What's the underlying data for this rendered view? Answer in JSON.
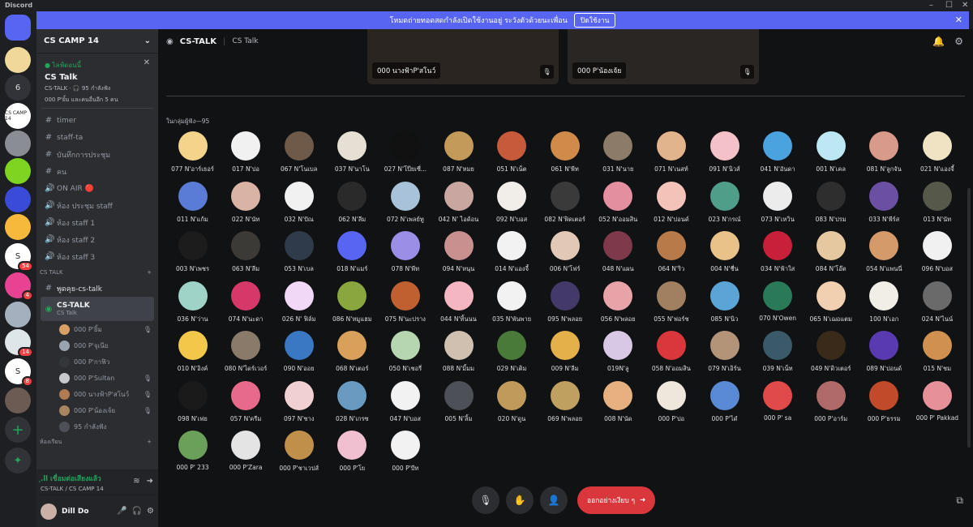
{
  "app": {
    "title": "Discord",
    "window_controls": [
      "–",
      "☐",
      "✕"
    ]
  },
  "banner": {
    "text": "โหมดถ่ายทอดสดกำลังเปิดใช้งานอยู่ ระวังตัวด้วยนะเพื่อน",
    "button": "ปิดใช้งาน",
    "close": "✕"
  },
  "rail": {
    "servers": [
      {
        "label": "",
        "color": "#5865f2",
        "icon": "discord-icon"
      },
      {
        "label": "",
        "color": "#f0d89a",
        "icon": "server-icon"
      },
      {
        "label": "6",
        "color": "#313338",
        "icon": ""
      },
      {
        "label": "CS CAMP 14",
        "color": "#ffffff",
        "icon": ""
      },
      {
        "label": "",
        "color": "#8a8d93",
        "icon": "server-icon"
      },
      {
        "label": "",
        "color": "#7fd321",
        "icon": ""
      },
      {
        "label": "",
        "color": "#3b4bd9",
        "icon": "server-icon"
      },
      {
        "label": "",
        "color": "#f6b93b",
        "icon": "server-icon"
      },
      {
        "label": "S",
        "color": "#ffffff",
        "icon": "",
        "badge": "54"
      },
      {
        "label": "",
        "color": "#e84393",
        "icon": "server-icon",
        "badge": "4"
      },
      {
        "label": "",
        "color": "#a4b0be",
        "icon": "server-icon"
      },
      {
        "label": "",
        "color": "#dfe6e9",
        "icon": "server-icon",
        "badge": "14"
      },
      {
        "label": "S",
        "color": "#ffffff",
        "icon": "",
        "badge": "8"
      },
      {
        "label": "",
        "color": "#6b5b53",
        "icon": "server-icon"
      }
    ],
    "add": "+",
    "explore": "✦"
  },
  "sidebar": {
    "server_name": "CS CAMP 14",
    "live": {
      "status": "● ไลฟ์ตอนนี้",
      "title": "CS Talk",
      "sub1": "CS-TALK · 🎧 95 กำลังฟัง",
      "sub2": "000 P'ยิ้ม และคนอื่นอีก 5 คน"
    },
    "channels_top": [
      {
        "icon": "#",
        "label": "timer"
      },
      {
        "icon": "#",
        "label": "staff-ta"
      },
      {
        "icon": "#",
        "label": "บันทึกการประชุม"
      },
      {
        "icon": "#",
        "label": "คน"
      },
      {
        "icon": "🔊",
        "label": "ON AIR 🔴"
      },
      {
        "icon": "🔊",
        "label": "ห้อง ประชุม staff"
      },
      {
        "icon": "🔊",
        "label": "ห้อง staff 1"
      },
      {
        "icon": "🔊",
        "label": "ห้อง staff 2"
      },
      {
        "icon": "🔊",
        "label": "ห้อง staff 3"
      }
    ],
    "category": "CS TALK",
    "channel_text": "พูดคุย-cs-talk",
    "stage": {
      "label": "CS-TALK",
      "sub": "CS Talk"
    },
    "voice_users": [
      {
        "name": "000 P'ยิ้ม",
        "color": "#d9a066"
      },
      {
        "name": "000 P'จุเนีย",
        "color": "#9aa3b0"
      },
      {
        "name": "000 P'กาฟิว",
        "color": "#33363b"
      },
      {
        "name": "000 P'Sultan",
        "color": "#c7c9cc"
      },
      {
        "name": "000 นางฟ้าP'สโนว์",
        "color": "#b07a52"
      },
      {
        "name": "000 P'น้องเจ้ย",
        "color": "#a6855f"
      },
      {
        "name": "95 กำลังฟัง",
        "color": "#4e5058"
      }
    ],
    "category2": "ห้องเรียน",
    "voice_status": {
      "title": "ฺ.ll เชื่อมต่อเสียงแล้ว",
      "sub": "CS-TALK / CS CAMP 14"
    },
    "user": {
      "name": "Dill Do"
    }
  },
  "header": {
    "name": "CS-TALK",
    "sub": "CS Talk"
  },
  "speakers": [
    {
      "name": "000 นางฟ้าP'สโนว์"
    },
    {
      "name": "000 P'น้องเจ้ย"
    }
  ],
  "audience_label": "ในกลุ่มผู้ฟัง—95",
  "audience": [
    {
      "name": "077 N'อาร์เธอร์",
      "color": "#f4d48a"
    },
    {
      "name": "017 N'ปอ",
      "color": "#f1f1f1"
    },
    {
      "name": "067 N'โนเบล",
      "color": "#6f5a4a"
    },
    {
      "name": "037 N'นาโน",
      "color": "#e6e0d4"
    },
    {
      "name": "027 N'โป๊ยเซี่...",
      "color": "#111111"
    },
    {
      "name": "087 N'หมย",
      "color": "#c49a5a"
    },
    {
      "name": "051 N'เน็ต",
      "color": "#c65a3a"
    },
    {
      "name": "061 N'พีท",
      "color": "#d08a4a"
    },
    {
      "name": "031 N'นาย",
      "color": "#8b7b68"
    },
    {
      "name": "071 N'เนสท์",
      "color": "#e2b48e"
    },
    {
      "name": "091 N'นิวส์",
      "color": "#f5c1c8"
    },
    {
      "name": "041 N'อันดา",
      "color": "#4aa3df"
    },
    {
      "name": "001 N'เคล",
      "color": "#bde7f2"
    },
    {
      "name": "081 N'ลูกจัน",
      "color": "#d89a8a"
    },
    {
      "name": "021 N'แองจี้",
      "color": "#efe3c3"
    },
    {
      "name": "011 N'แก้ม",
      "color": "#5a7bd6"
    },
    {
      "name": "022 N'นัท",
      "color": "#d9b3a4"
    },
    {
      "name": "032 N'ปัณ",
      "color": "#f1f1f1"
    },
    {
      "name": "062 N'ลีม",
      "color": "#2a2a2a"
    },
    {
      "name": "072 N'เพลย์ทู",
      "color": "#a7c2d9"
    },
    {
      "name": "042 N' ไอด้อน",
      "color": "#c9a7a0"
    },
    {
      "name": "092 N'บอส",
      "color": "#f1eeea"
    },
    {
      "name": "082 N'ฟิดเตอร์",
      "color": "#3a3a3a"
    },
    {
      "name": "052 N'ออมสิน",
      "color": "#e48fa0"
    },
    {
      "name": "012 N'ปอนด์",
      "color": "#f3c3b9"
    },
    {
      "name": "023 N'กรณ์",
      "color": "#4f9e8a"
    },
    {
      "name": "073 N'เหวิน",
      "color": "#ececec"
    },
    {
      "name": "083 N'ปรม",
      "color": "#2e2e2e"
    },
    {
      "name": "033 N'พีร์ส",
      "color": "#6a4fa3"
    },
    {
      "name": "013 N'นัท",
      "color": "#56584a"
    },
    {
      "name": "003 N'เพชร",
      "color": "#1c1c1c"
    },
    {
      "name": "063 N'ลีม",
      "color": "#3c3a36"
    },
    {
      "name": "053 N'เบล",
      "color": "#2f3b4a"
    },
    {
      "name": "018 N'แมร์",
      "color": "#5865f2"
    },
    {
      "name": "078 N'พีท",
      "color": "#9a8ee6"
    },
    {
      "name": "094 N'หนุน",
      "color": "#c99090"
    },
    {
      "name": "014 N'แองจี้",
      "color": "#f2f2f2"
    },
    {
      "name": "006 N'โฟร์",
      "color": "#e2c8b6"
    },
    {
      "name": "048 N'แผน",
      "color": "#7e3a4a"
    },
    {
      "name": "064 N'ริว",
      "color": "#b97a4a"
    },
    {
      "name": "004 N'ชื่น",
      "color": "#e9c28a"
    },
    {
      "name": "034 N'ฟ้าใส",
      "color": "#c8203a"
    },
    {
      "name": "084 N'โอ๊ต",
      "color": "#e6c8a0"
    },
    {
      "name": "054 N'แพนนี่",
      "color": "#d49a6a"
    },
    {
      "name": "096 N'บอส",
      "color": "#f1f1f1"
    },
    {
      "name": "036 N'ว่าน",
      "color": "#9fd3c7"
    },
    {
      "name": "074 N'นะดา",
      "color": "#d6386a"
    },
    {
      "name": "026 N' ฟิล์ม",
      "color": "#f0d8f6"
    },
    {
      "name": "086 N'หมูแฮม",
      "color": "#8aa63f"
    },
    {
      "name": "075 N'นะปราง",
      "color": "#c06030"
    },
    {
      "name": "044 N'ทิ้นนน",
      "color": "#f4b6c0"
    },
    {
      "name": "035 N'พันพาย",
      "color": "#f2f2f2"
    },
    {
      "name": "095 N'พลอย",
      "color": "#433a6a"
    },
    {
      "name": "056 N'พลอย",
      "color": "#e8a3a8"
    },
    {
      "name": "055 N'ฟอร์ช",
      "color": "#a08060"
    },
    {
      "name": "085 N'นิว",
      "color": "#5aa5d6"
    },
    {
      "name": "070 N'Owen",
      "color": "#2a7a5a"
    },
    {
      "name": "065 N'เฌอแตม",
      "color": "#f0d0b0"
    },
    {
      "name": "100 N'เอก",
      "color": "#f1ede7"
    },
    {
      "name": "024 N'ไนน์",
      "color": "#6a6a6a"
    },
    {
      "name": "010 N'อิงค์",
      "color": "#f2c84a"
    },
    {
      "name": "080 N'ไดร์เวอร์",
      "color": "#8a7a6a"
    },
    {
      "name": "090 N'ออย",
      "color": "#3a78c4"
    },
    {
      "name": "068 N'เตอร์",
      "color": "#d8a05a"
    },
    {
      "name": "050 N'เชอรี่",
      "color": "#b6d6b0"
    },
    {
      "name": "088 N'มิ้มม",
      "color": "#d0c0b0"
    },
    {
      "name": "029 N'เติม",
      "color": "#4a7a3a"
    },
    {
      "name": "009 N'ลีม",
      "color": "#e3b04a"
    },
    {
      "name": "019N'ลู",
      "color": "#d8c8e6"
    },
    {
      "name": "058 N'ออมสิน",
      "color": "#da373c"
    },
    {
      "name": "079 N'เอิร์น",
      "color": "#b49478"
    },
    {
      "name": "039 N'เน็ท",
      "color": "#3a5a6a"
    },
    {
      "name": "049 N'ดิวเตอร์",
      "color": "#3a2a1a"
    },
    {
      "name": "089 N'ปอนด์",
      "color": "#5a3ab0"
    },
    {
      "name": "015 N'ชม",
      "color": "#d09050"
    },
    {
      "name": "098 N'เฟย",
      "color": "#1a1a1a"
    },
    {
      "name": "057 N'ครีม",
      "color": "#e86a8a"
    },
    {
      "name": "097 N'ชาง",
      "color": "#f0d0d0"
    },
    {
      "name": "028 N'เกรซ",
      "color": "#6a9ac0"
    },
    {
      "name": "047 N'บอส",
      "color": "#f2f2f2"
    },
    {
      "name": "005 N'ลิ้ม",
      "color": "#4e5058"
    },
    {
      "name": "020 N'ดูน",
      "color": "#c09a5a"
    },
    {
      "name": "069 N'พลอย",
      "color": "#c0a060"
    },
    {
      "name": "008 N'นัด",
      "color": "#e6b080"
    },
    {
      "name": "000 P'ปอ",
      "color": "#efe7dc"
    },
    {
      "name": "000 P'ไดํ",
      "color": "#5a8ad6"
    },
    {
      "name": "000 P' sa",
      "color": "#e04a4a"
    },
    {
      "name": "000 P'อาร์ม",
      "color": "#b06a6a"
    },
    {
      "name": "000 P'ธรรม",
      "color": "#c04a2a"
    },
    {
      "name": "000 P' Pakkad",
      "color": "#e6909a"
    },
    {
      "name": "000 P' 233",
      "color": "#6aa05a"
    },
    {
      "name": "000 P'Zara",
      "color": "#e4e4e4"
    },
    {
      "name": "000 P'ชาเวปส์",
      "color": "#c0904a"
    },
    {
      "name": "000 P'โย",
      "color": "#f0c0d0"
    },
    {
      "name": "000 P'บีท",
      "color": "#f2f2f2"
    }
  ],
  "controls": {
    "leave": "ออกอย่างเงียบ ๆ"
  }
}
